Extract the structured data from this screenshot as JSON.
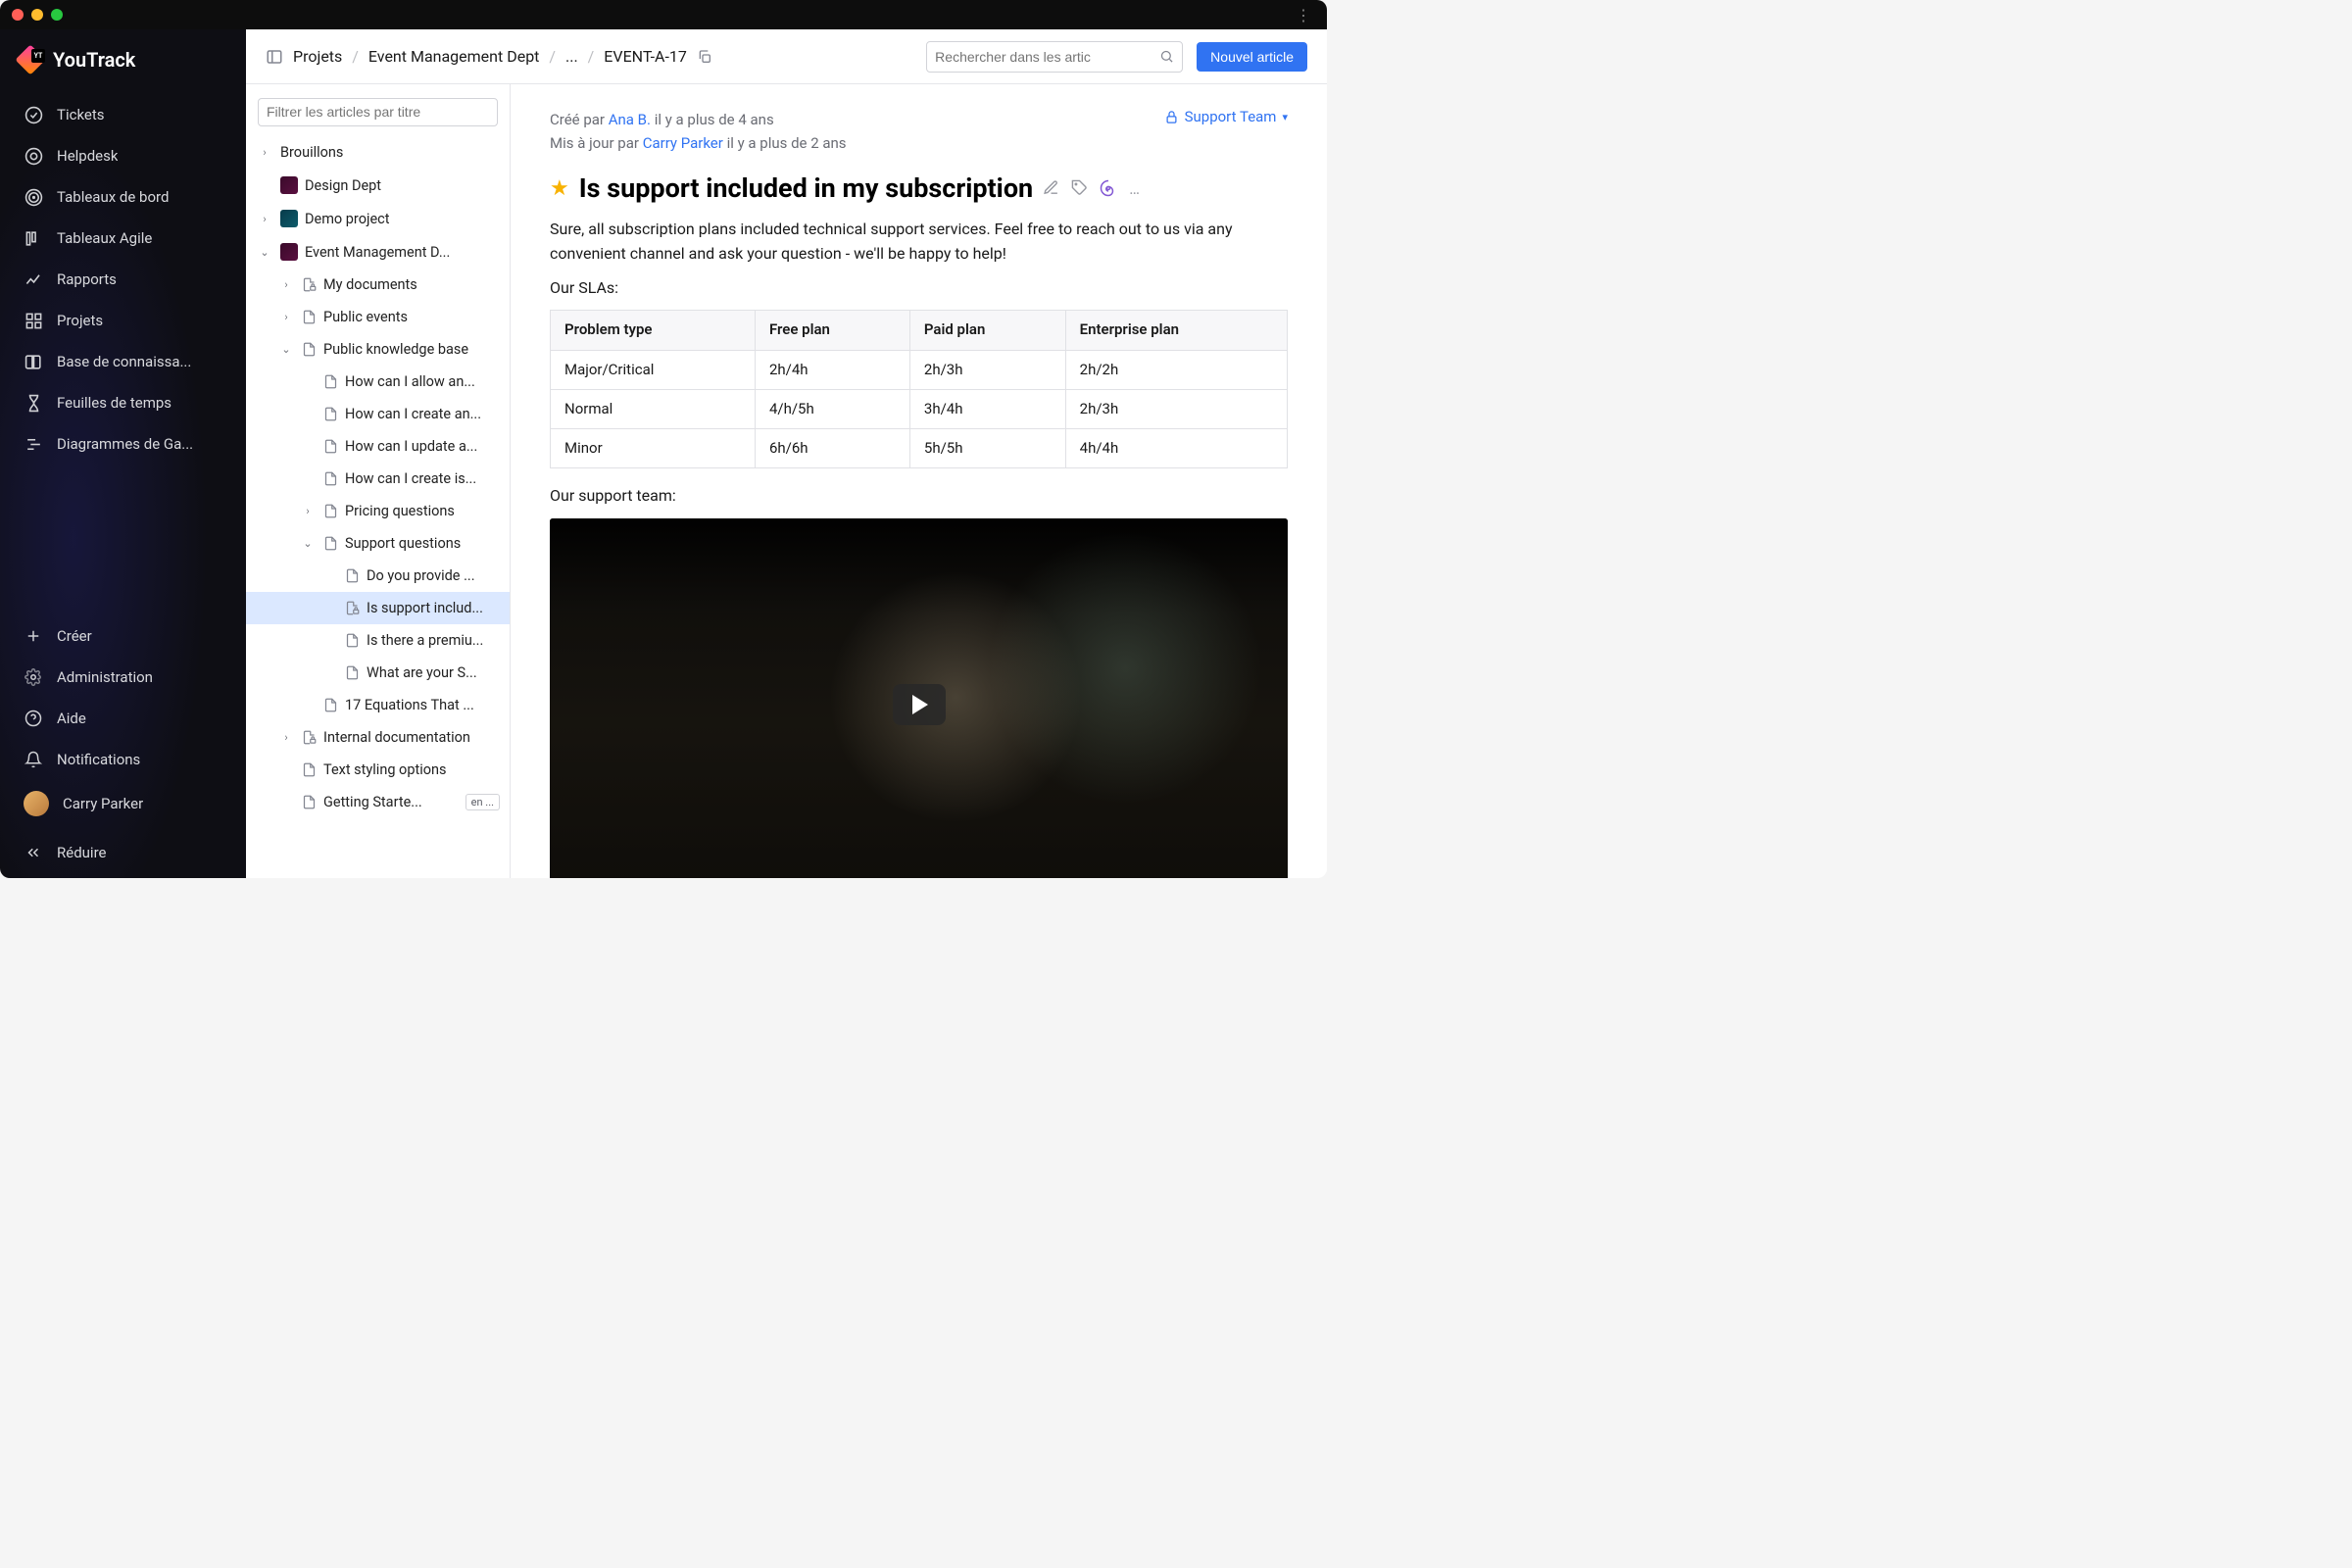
{
  "app_name": "YouTrack",
  "sidebar": {
    "items": [
      {
        "label": "Tickets",
        "icon": "check-circle"
      },
      {
        "label": "Helpdesk",
        "icon": "lifebuoy"
      },
      {
        "label": "Tableaux de bord",
        "icon": "target"
      },
      {
        "label": "Tableaux Agile",
        "icon": "columns"
      },
      {
        "label": "Rapports",
        "icon": "chart"
      },
      {
        "label": "Projets",
        "icon": "grid"
      },
      {
        "label": "Base de connaissa...",
        "icon": "book"
      },
      {
        "label": "Feuilles de temps",
        "icon": "hourglass"
      },
      {
        "label": "Diagrammes de Ga...",
        "icon": "gantt"
      }
    ],
    "create": "Créer",
    "admin": "Administration",
    "help": "Aide",
    "notifications": "Notifications",
    "user": "Carry Parker",
    "collapse": "Réduire"
  },
  "header": {
    "breadcrumb": [
      "Projets",
      "Event Management Dept",
      "...",
      "EVENT-A-17"
    ],
    "search_placeholder": "Rechercher dans les artic",
    "new_article": "Nouvel article"
  },
  "tree": {
    "filter_placeholder": "Filtrer les articles par titre",
    "items": [
      {
        "label": "Brouillons",
        "depth": 0,
        "expand": "closed",
        "icon": "none"
      },
      {
        "label": "Design Dept",
        "depth": 0,
        "expand": "none",
        "icon": "proj-pink"
      },
      {
        "label": "Demo project",
        "depth": 0,
        "expand": "closed",
        "icon": "proj-blue"
      },
      {
        "label": "Event Management D...",
        "depth": 0,
        "expand": "open",
        "icon": "proj-pink"
      },
      {
        "label": "My documents",
        "depth": 1,
        "expand": "closed",
        "icon": "doc-lock"
      },
      {
        "label": "Public events",
        "depth": 1,
        "expand": "closed",
        "icon": "doc"
      },
      {
        "label": "Public knowledge base",
        "depth": 1,
        "expand": "open",
        "icon": "doc"
      },
      {
        "label": "How can I allow an...",
        "depth": 2,
        "expand": "none",
        "icon": "doc"
      },
      {
        "label": "How can I create an...",
        "depth": 2,
        "expand": "none",
        "icon": "doc"
      },
      {
        "label": "How can I update a...",
        "depth": 2,
        "expand": "none",
        "icon": "doc"
      },
      {
        "label": "How can I create is...",
        "depth": 2,
        "expand": "none",
        "icon": "doc"
      },
      {
        "label": "Pricing questions",
        "depth": 2,
        "expand": "closed",
        "icon": "doc"
      },
      {
        "label": "Support questions",
        "depth": 2,
        "expand": "open",
        "icon": "doc"
      },
      {
        "label": "Do you provide ...",
        "depth": 3,
        "expand": "none",
        "icon": "doc"
      },
      {
        "label": "Is support includ...",
        "depth": 3,
        "expand": "none",
        "icon": "doc-lock",
        "selected": true
      },
      {
        "label": "Is there a premiu...",
        "depth": 3,
        "expand": "none",
        "icon": "doc"
      },
      {
        "label": "What are your S...",
        "depth": 3,
        "expand": "none",
        "icon": "doc"
      },
      {
        "label": "17 Equations That ...",
        "depth": 2,
        "expand": "none",
        "icon": "doc"
      },
      {
        "label": "Internal documentation",
        "depth": 1,
        "expand": "closed",
        "icon": "doc-lock"
      },
      {
        "label": "Text styling options",
        "depth": 1,
        "expand": "none",
        "icon": "doc"
      },
      {
        "label": "Getting Starte...",
        "depth": 1,
        "expand": "none",
        "icon": "doc",
        "badge": "en ..."
      }
    ]
  },
  "article": {
    "created_prefix": "Créé par ",
    "created_by": "Ana B.",
    "created_when": " il y a plus de 4 ans",
    "updated_prefix": "Mis à jour par ",
    "updated_by": "Carry Parker",
    "updated_when": " il y a plus de 2 ans",
    "visibility": "Support Team",
    "title": "Is support included in my subscription",
    "intro": "Sure, all subscription plans included technical support services. Feel free to reach out to us via any convenient channel and ask your question - we'll be happy to help!",
    "sla_label": "Our SLAs:",
    "support_team_label": "Our support team:"
  },
  "chart_data": {
    "type": "table",
    "title": "Our SLAs:",
    "columns": [
      "Problem type",
      "Free plan",
      "Paid plan",
      "Enterprise plan"
    ],
    "rows": [
      [
        "Major/Critical",
        "2h/4h",
        "2h/3h",
        "2h/2h"
      ],
      [
        "Normal",
        "4/h/5h",
        "3h/4h",
        "2h/3h"
      ],
      [
        "Minor",
        "6h/6h",
        "5h/5h",
        "4h/4h"
      ]
    ]
  }
}
